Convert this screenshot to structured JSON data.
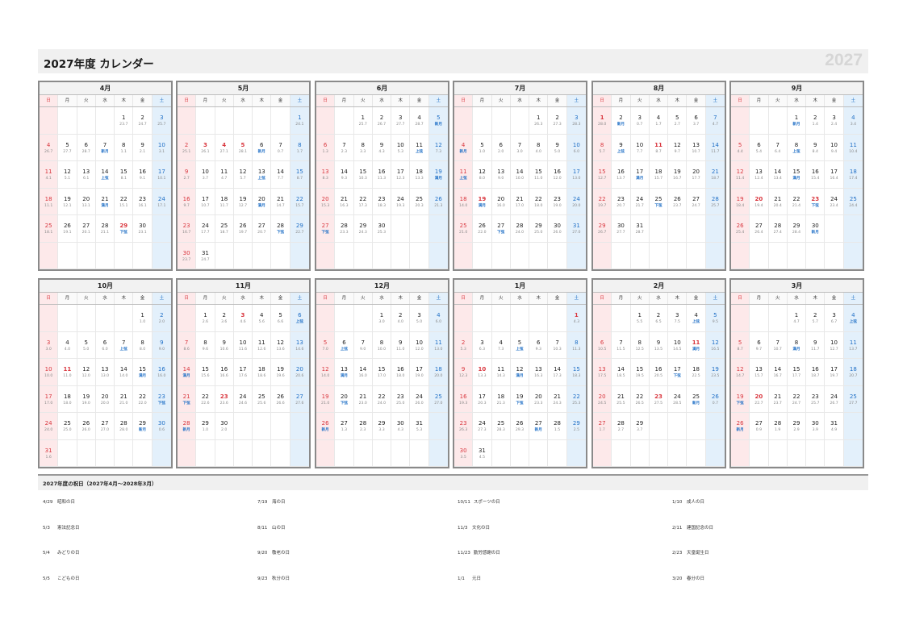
{
  "header": {
    "title": "2027年度 カレンダー",
    "year": "2027"
  },
  "weekdays": [
    "日",
    "月",
    "火",
    "水",
    "木",
    "金",
    "土"
  ],
  "months": [
    {
      "name": "4月",
      "start": 4,
      "days": 30,
      "hol": [
        29
      ],
      "sub": [
        "23.7",
        "24.7",
        "25.7",
        "26.7",
        "27.7",
        "28.7",
        "新月",
        "1.1",
        "2.1",
        "3.1",
        "4.1",
        "5.1",
        "6.1",
        "上弦",
        "8.1",
        "9.1",
        "10.1",
        "11.1",
        "12.1",
        "13.1",
        "満月",
        "15.1",
        "16.1",
        "17.1",
        "18.1",
        "19.1",
        "20.1",
        "21.1",
        "下弦",
        "23.1"
      ]
    },
    {
      "name": "5月",
      "start": 6,
      "days": 31,
      "hol": [
        3,
        4,
        5
      ],
      "sub": [
        "24.1",
        "25.1",
        "26.1",
        "27.1",
        "28.1",
        "新月",
        "0.7",
        "1.7",
        "2.7",
        "3.7",
        "4.7",
        "5.7",
        "上弦",
        "7.7",
        "8.7",
        "9.7",
        "10.7",
        "11.7",
        "12.7",
        "満月",
        "14.7",
        "15.7",
        "16.7",
        "17.7",
        "18.7",
        "19.7",
        "20.7",
        "下弦",
        "22.7",
        "23.7",
        "24.7"
      ]
    },
    {
      "name": "6月",
      "start": 2,
      "days": 30,
      "hol": [],
      "sub": [
        "25.7",
        "26.7",
        "27.7",
        "28.7",
        "新月",
        "1.3",
        "2.3",
        "3.3",
        "4.3",
        "5.3",
        "上弦",
        "7.3",
        "8.3",
        "9.3",
        "10.3",
        "11.3",
        "12.3",
        "13.3",
        "満月",
        "15.3",
        "16.3",
        "17.3",
        "18.3",
        "19.3",
        "20.3",
        "21.3",
        "下弦",
        "23.3",
        "24.3",
        "25.3"
      ]
    },
    {
      "name": "7月",
      "start": 4,
      "days": 31,
      "hol": [
        19
      ],
      "sub": [
        "26.3",
        "27.3",
        "28.3",
        "新月",
        "1.0",
        "2.0",
        "3.0",
        "4.0",
        "5.0",
        "6.0",
        "上弦",
        "8.0",
        "9.0",
        "10.0",
        "11.0",
        "12.0",
        "13.0",
        "14.0",
        "満月",
        "16.0",
        "17.0",
        "18.0",
        "19.0",
        "20.0",
        "21.0",
        "22.0",
        "下弦",
        "24.0",
        "25.0",
        "26.0",
        "27.0"
      ]
    },
    {
      "name": "8月",
      "start": 0,
      "days": 31,
      "hol": [
        1,
        11
      ],
      "sub": [
        "28.0",
        "新月",
        "0.7",
        "1.7",
        "2.7",
        "3.7",
        "4.7",
        "5.7",
        "上弦",
        "7.7",
        "8.7",
        "9.7",
        "10.7",
        "11.7",
        "12.7",
        "13.7",
        "満月",
        "15.7",
        "16.7",
        "17.7",
        "18.7",
        "19.7",
        "20.7",
        "21.7",
        "下弦",
        "23.7",
        "24.7",
        "25.7",
        "26.7",
        "27.7",
        "28.7"
      ]
    },
    {
      "name": "9月",
      "start": 3,
      "days": 30,
      "hol": [
        20,
        23
      ],
      "sub": [
        "新月",
        "1.4",
        "2.4",
        "3.4",
        "4.4",
        "5.4",
        "6.4",
        "上弦",
        "8.4",
        "9.4",
        "10.4",
        "11.4",
        "12.4",
        "13.4",
        "満月",
        "15.4",
        "16.4",
        "17.4",
        "18.4",
        "19.4",
        "20.4",
        "21.4",
        "下弦",
        "23.4",
        "24.4",
        "25.4",
        "26.4",
        "27.4",
        "28.4",
        "新月"
      ]
    },
    {
      "name": "10月",
      "start": 5,
      "days": 31,
      "hol": [
        11
      ],
      "sub": [
        "1.0",
        "2.0",
        "3.0",
        "4.0",
        "5.0",
        "6.0",
        "上弦",
        "8.0",
        "9.0",
        "10.0",
        "11.0",
        "12.0",
        "13.0",
        "14.0",
        "満月",
        "16.0",
        "17.0",
        "18.0",
        "19.0",
        "20.0",
        "21.0",
        "22.0",
        "下弦",
        "24.0",
        "25.0",
        "26.0",
        "27.0",
        "28.0",
        "新月",
        "0.6",
        "1.6"
      ]
    },
    {
      "name": "11月",
      "start": 1,
      "days": 30,
      "hol": [
        3,
        23
      ],
      "sub": [
        "2.6",
        "3.6",
        "4.6",
        "5.6",
        "6.6",
        "上弦",
        "8.6",
        "9.6",
        "10.6",
        "11.6",
        "12.6",
        "13.6",
        "14.6",
        "満月",
        "15.6",
        "16.6",
        "17.6",
        "18.6",
        "19.6",
        "20.6",
        "下弦",
        "22.6",
        "23.6",
        "24.6",
        "25.6",
        "26.6",
        "27.6",
        "新月",
        "1.0",
        "2.0"
      ]
    },
    {
      "name": "12月",
      "start": 3,
      "days": 31,
      "hol": [],
      "sub": [
        "3.0",
        "4.0",
        "5.0",
        "6.0",
        "7.0",
        "上弦",
        "9.0",
        "10.0",
        "11.0",
        "12.0",
        "13.0",
        "14.0",
        "満月",
        "16.0",
        "17.0",
        "18.0",
        "19.0",
        "20.0",
        "21.0",
        "下弦",
        "23.0",
        "24.0",
        "25.0",
        "26.0",
        "27.0",
        "新月",
        "1.3",
        "2.3",
        "3.3",
        "4.3",
        "5.3"
      ]
    },
    {
      "name": "1月",
      "start": 6,
      "days": 31,
      "hol": [
        1,
        10
      ],
      "sub": [
        "4.3",
        "5.3",
        "6.3",
        "7.3",
        "上弦",
        "9.3",
        "10.3",
        "11.3",
        "12.3",
        "13.3",
        "14.3",
        "満月",
        "16.3",
        "17.3",
        "18.3",
        "19.3",
        "20.3",
        "21.3",
        "下弦",
        "23.3",
        "24.3",
        "25.3",
        "26.3",
        "27.3",
        "28.3",
        "29.3",
        "新月",
        "1.5",
        "2.5",
        "3.5",
        "4.5"
      ]
    },
    {
      "name": "2月",
      "start": 2,
      "days": 29,
      "hol": [
        11,
        23
      ],
      "sub": [
        "5.5",
        "6.5",
        "7.5",
        "上弦",
        "9.5",
        "10.5",
        "11.5",
        "12.5",
        "13.5",
        "14.5",
        "満月",
        "16.5",
        "17.5",
        "18.5",
        "19.5",
        "20.5",
        "下弦",
        "22.5",
        "23.5",
        "24.5",
        "25.5",
        "26.5",
        "27.5",
        "28.5",
        "新月",
        "0.7",
        "1.7",
        "2.7",
        "3.7"
      ]
    },
    {
      "name": "3月",
      "start": 3,
      "days": 31,
      "hol": [
        20
      ],
      "sub": [
        "4.7",
        "5.7",
        "6.7",
        "上弦",
        "8.7",
        "9.7",
        "10.7",
        "満月",
        "11.7",
        "12.7",
        "13.7",
        "14.7",
        "15.7",
        "16.7",
        "17.7",
        "18.7",
        "19.7",
        "20.7",
        "下弦",
        "22.7",
        "23.7",
        "24.7",
        "25.7",
        "26.7",
        "27.7",
        "新月",
        "0.9",
        "1.9",
        "2.9",
        "3.9",
        "4.9"
      ]
    }
  ],
  "holidays": {
    "title": "2027年度の祝日（2027年4月〜2028年3月）",
    "items": [
      {
        "date": "4/29",
        "name": "昭和の日"
      },
      {
        "date": "5/3",
        "name": "憲法記念日"
      },
      {
        "date": "5/4",
        "name": "みどりの日"
      },
      {
        "date": "5/5",
        "name": "こどもの日"
      },
      {
        "date": "7/19",
        "name": "海の日"
      },
      {
        "date": "8/11",
        "name": "山の日"
      },
      {
        "date": "9/20",
        "name": "敬老の日"
      },
      {
        "date": "9/23",
        "name": "秋分の日"
      },
      {
        "date": "10/11",
        "name": "スポーツの日"
      },
      {
        "date": "11/3",
        "name": "文化の日"
      },
      {
        "date": "11/23",
        "name": "勤労感謝の日"
      },
      {
        "date": "1/1",
        "name": "元日"
      },
      {
        "date": "1/10",
        "name": "成人の日"
      },
      {
        "date": "2/11",
        "name": "建国記念の日"
      },
      {
        "date": "2/23",
        "name": "天皇誕生日"
      },
      {
        "date": "3/20",
        "name": "春分の日"
      }
    ]
  },
  "colors": {
    "sunday": "#d9363e",
    "saturday": "#1f6fc6",
    "holiday": "#d9363e",
    "moon_phase": "#1f6fc6"
  }
}
